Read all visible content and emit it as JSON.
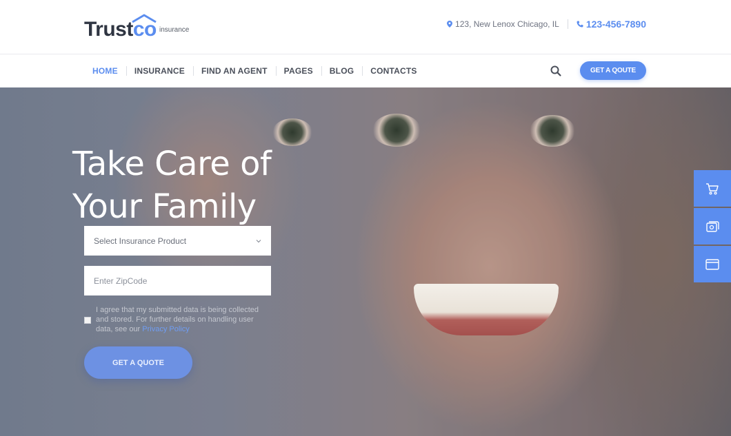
{
  "brand": {
    "name_part1": "Trust",
    "name_part2": "co",
    "tagline": "insurance",
    "accent_color": "#5b8def"
  },
  "header": {
    "address": "123, New Lenox Chicago, IL",
    "address_icon": "map-pin-icon",
    "phone": "123-456-7890",
    "phone_icon": "phone-icon"
  },
  "nav": {
    "items": [
      {
        "label": "HOME",
        "active": true
      },
      {
        "label": "INSURANCE",
        "active": false
      },
      {
        "label": "FIND AN AGENT",
        "active": false
      },
      {
        "label": "PAGES",
        "active": false
      },
      {
        "label": "BLOG",
        "active": false
      },
      {
        "label": "CONTACTS",
        "active": false
      }
    ],
    "search_icon": "search-icon",
    "quote_button": "GET A QOUTE"
  },
  "hero": {
    "title_line1": "Take Care of",
    "title_line2": "Your Family",
    "select_placeholder": "Select Insurance Product",
    "zip_placeholder": "Enter ZipCode",
    "agree_text": "I agree that my submitted data is being collected and stored. For further details on handling user data, see our ",
    "agree_link": "Privacy Policy",
    "quote_button": "GET A QUOTE"
  },
  "side_panel": {
    "icons": [
      "cart-icon",
      "documents-icon",
      "window-icon"
    ]
  }
}
